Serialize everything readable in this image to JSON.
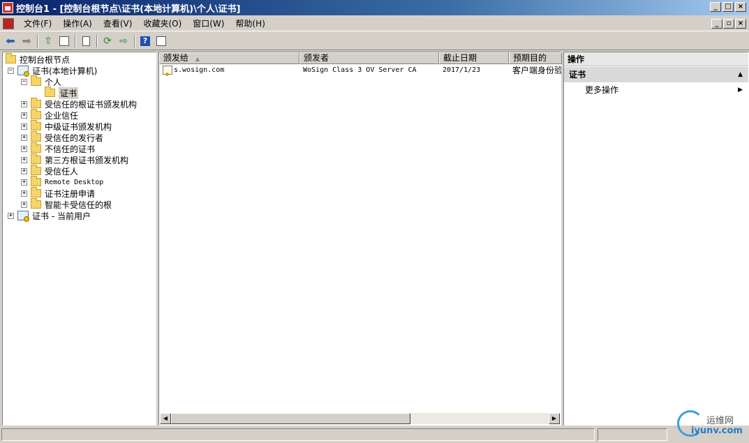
{
  "window": {
    "title": "控制台1 - [控制台根节点\\证书(本地计算机)\\个人\\证书]",
    "controls": [
      "_",
      "□",
      "×"
    ]
  },
  "menubar": {
    "items": [
      "文件(F)",
      "操作(A)",
      "查看(V)",
      "收藏夹(O)",
      "窗口(W)",
      "帮助(H)"
    ],
    "mdi_controls": [
      "_",
      "▫",
      "×"
    ]
  },
  "toolbar": {
    "buttons": [
      "back-icon",
      "forward-icon",
      "up-icon",
      "show-hide-tree-icon",
      "properties-icon",
      "refresh-icon",
      "export-list-icon",
      "help-icon",
      "show-hide-action-pane-icon"
    ]
  },
  "tree": {
    "root": "控制台根节点",
    "nodes": [
      {
        "label": "证书(本地计算机)",
        "expander": "−"
      },
      {
        "label": "个人",
        "expander": "−"
      },
      {
        "label": "证书",
        "expander": ""
      },
      {
        "label": "受信任的根证书颁发机构",
        "expander": "+"
      },
      {
        "label": "企业信任",
        "expander": "+"
      },
      {
        "label": "中级证书颁发机构",
        "expander": "+"
      },
      {
        "label": "受信任的发行者",
        "expander": "+"
      },
      {
        "label": "不信任的证书",
        "expander": "+"
      },
      {
        "label": "第三方根证书颁发机构",
        "expander": "+"
      },
      {
        "label": "受信任人",
        "expander": "+"
      },
      {
        "label": "Remote Desktop",
        "expander": "+"
      },
      {
        "label": "证书注册申请",
        "expander": "+"
      },
      {
        "label": "智能卡受信任的根",
        "expander": "+"
      },
      {
        "label": "证书 - 当前用户",
        "expander": "+"
      }
    ]
  },
  "list": {
    "columns": [
      "颁发给",
      "颁发者",
      "截止日期",
      "预期目的"
    ],
    "sort_indicator": "▲",
    "rows": [
      {
        "issued_to": "s.wosign.com",
        "issued_by": "WoSign Class 3 OV Server CA",
        "expiration": "2017/1/23",
        "purpose": "客户端身份验"
      }
    ]
  },
  "actions": {
    "header": "操作",
    "section": "证书",
    "items": [
      "更多操作"
    ]
  },
  "watermark": {
    "cn": "运维网",
    "en": "iyunv.com"
  }
}
